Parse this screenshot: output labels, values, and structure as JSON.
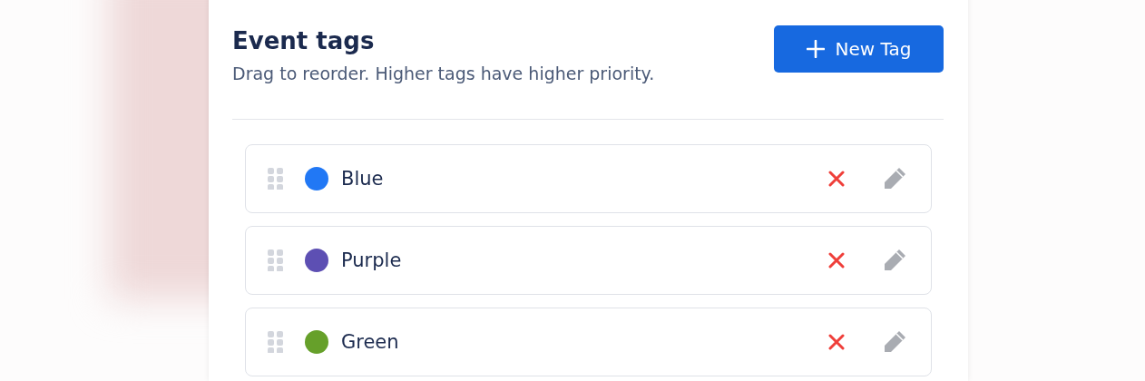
{
  "header": {
    "title": "Event tags",
    "subtitle": "Drag to reorder. Higher tags have higher priority."
  },
  "new_button": {
    "label": "New Tag"
  },
  "tags": [
    {
      "name": "Blue",
      "color": "#2178f5"
    },
    {
      "name": "Purple",
      "color": "#5d4fb3"
    },
    {
      "name": "Green",
      "color": "#66a02a"
    }
  ]
}
